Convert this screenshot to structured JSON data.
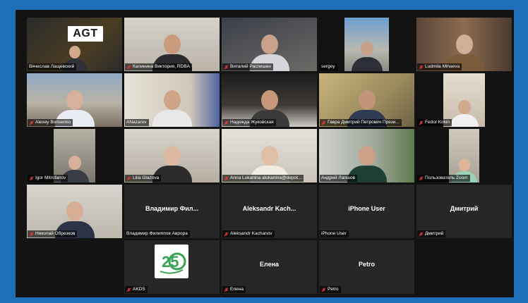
{
  "meeting": {
    "participants": [
      {
        "name": "Вячеслав Лащевский",
        "muted": false,
        "speaking": true
      },
      {
        "name": "Калинина Виктория, RDBA",
        "muted": true
      },
      {
        "name": "Виталий Распишин",
        "muted": true
      },
      {
        "name": "sergey",
        "muted": false
      },
      {
        "name": "Ludmila Mihaeva",
        "muted": true
      },
      {
        "name": "Alexey Borisenko",
        "muted": true
      },
      {
        "name": "ANazarov",
        "muted": false
      },
      {
        "name": "Надежда Жуковская",
        "muted": true
      },
      {
        "name": "Гавра Дмитрий Петрович Прези...",
        "muted": true
      },
      {
        "name": "Fedor Kirkin",
        "muted": true
      },
      {
        "name": "Igor Mitrofanov",
        "muted": true
      },
      {
        "name": "Lilia Glazova",
        "muted": true
      },
      {
        "name": "Anna Lukanina alukanina@depot...",
        "muted": true
      },
      {
        "name": "Андрей Лапшов",
        "muted": false
      },
      {
        "name": "Пользователь Zoom",
        "muted": true
      },
      {
        "name": "Николай Обрезков",
        "muted": true
      },
      {
        "name": "Владимир Филиппов Аврора",
        "muted": false,
        "display_name": "Владимир Фил..."
      },
      {
        "name": "Aleksandr Kachanov",
        "muted": true,
        "display_name": "Aleksandr Kach..."
      },
      {
        "name": "iPhone User",
        "muted": false,
        "display_name": "iPhone User"
      },
      {
        "name": "Дмитрий",
        "muted": true,
        "display_name": "Дмитрий"
      },
      {
        "name": "AKDS",
        "muted": true,
        "logo_text": "25"
      },
      {
        "name": "Елена",
        "muted": true,
        "display_name": "Елена"
      },
      {
        "name": "Petro",
        "muted": true,
        "display_name": "Petro"
      }
    ],
    "logos": {
      "agt": "AGT"
    }
  },
  "colors": {
    "frame_border": "#1f6fb8",
    "muted_icon": "#e23b3b",
    "active_speaker": "#f2d64b",
    "akds_green": "#3aa356"
  }
}
